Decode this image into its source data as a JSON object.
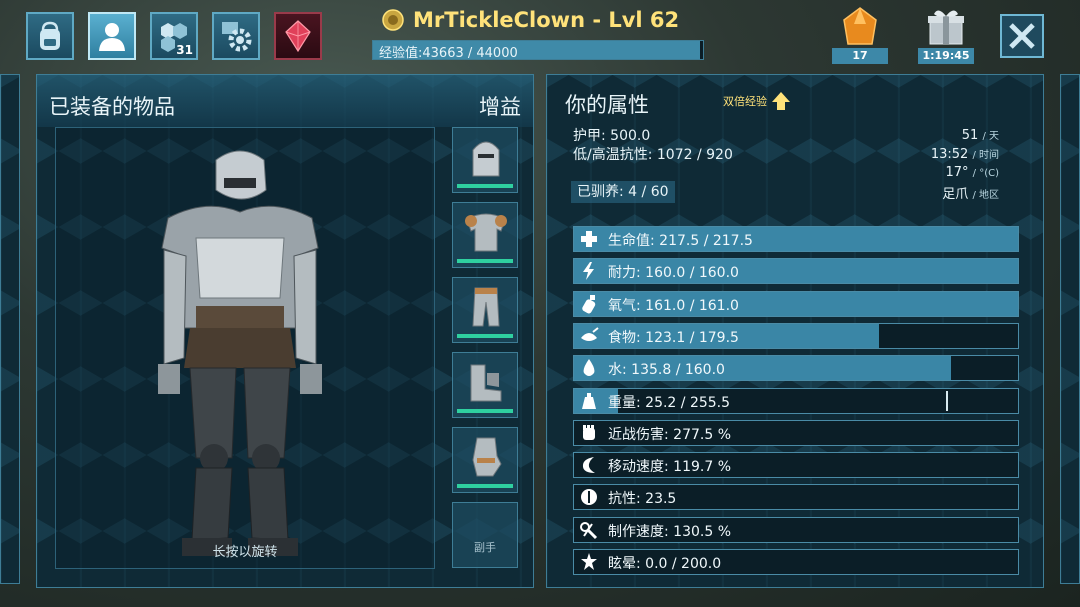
{
  "topbar": {
    "icons": [
      {
        "name": "backpack-icon"
      },
      {
        "name": "player-icon"
      },
      {
        "name": "engrams-icon",
        "badge": "31"
      },
      {
        "name": "settings-icon"
      },
      {
        "name": "element-icon"
      }
    ],
    "player_name": "MrTickleClown - Lvl 62",
    "xp_label": "经验值:43663 / 44000",
    "xp_progress": 0.9923,
    "gem_count": "17",
    "gift_timer": "1:19:45"
  },
  "equipment": {
    "title": "已装备的物品",
    "buff_title": "增益",
    "rotate_hint": "长按以旋转",
    "slots": [
      {
        "name": "helmet-slot",
        "icon": "helmet-icon",
        "durability": 1.0
      },
      {
        "name": "chest-slot",
        "icon": "chestplate-icon",
        "durability": 1.0
      },
      {
        "name": "legs-slot",
        "icon": "leggings-icon",
        "durability": 1.0
      },
      {
        "name": "boots-slot",
        "icon": "boots-icon",
        "durability": 1.0
      },
      {
        "name": "gloves-slot",
        "icon": "gauntlets-icon",
        "durability": 1.0
      },
      {
        "name": "offhand-slot",
        "label": "副手"
      }
    ]
  },
  "stats": {
    "title": "你的属性",
    "double_xp": "双倍经验",
    "armor": "护甲: 500.0",
    "temp_resist": "低/高温抗性: 1072 / 920",
    "tamed": "已驯养: 4 / 60",
    "world": {
      "day": "51",
      "day_unit": "/ 天",
      "time": "13:52",
      "time_unit": "/ 时间",
      "temp": "17°",
      "temp_unit": "/ °(C)",
      "area": "足爪",
      "area_unit": "/ 地区"
    },
    "bars": [
      {
        "name": "health",
        "icon": "cross-icon",
        "label": "生命值: 217.5 / 217.5",
        "fill": 1.0
      },
      {
        "name": "stamina",
        "icon": "lightning-icon",
        "label": "耐力: 160.0 / 160.0",
        "fill": 1.0
      },
      {
        "name": "oxygen",
        "icon": "oxygen-tank-icon",
        "label": "氧气: 161.0 / 161.0",
        "fill": 1.0
      },
      {
        "name": "food",
        "icon": "food-icon",
        "label": "食物: 123.1 / 179.5",
        "fill": 0.686
      },
      {
        "name": "water",
        "icon": "water-drop-icon",
        "label": "水: 135.8 / 160.0",
        "fill": 0.849
      },
      {
        "name": "weight",
        "icon": "weight-icon",
        "label": "重量: 25.2 / 255.5",
        "fill": 0.099,
        "mark": 0.837
      },
      {
        "name": "melee",
        "icon": "fist-icon",
        "label": "近战伤害: 277.5 %",
        "fill": 0
      },
      {
        "name": "speed",
        "icon": "speed-icon",
        "label": "移动速度: 119.7 %",
        "fill": 0
      },
      {
        "name": "fortitude",
        "icon": "fortitude-icon",
        "label": "抗性: 23.5",
        "fill": 0
      },
      {
        "name": "crafting",
        "icon": "crafting-icon",
        "label": "制作速度: 130.5 %",
        "fill": 0
      },
      {
        "name": "torpor",
        "icon": "torpor-icon",
        "label": "眩晕: 0.0 / 200.0",
        "fill": 0
      }
    ]
  },
  "colors": {
    "accent": "#3a86a6",
    "gold": "#ffe27a",
    "durability": "#2fd0a0"
  }
}
